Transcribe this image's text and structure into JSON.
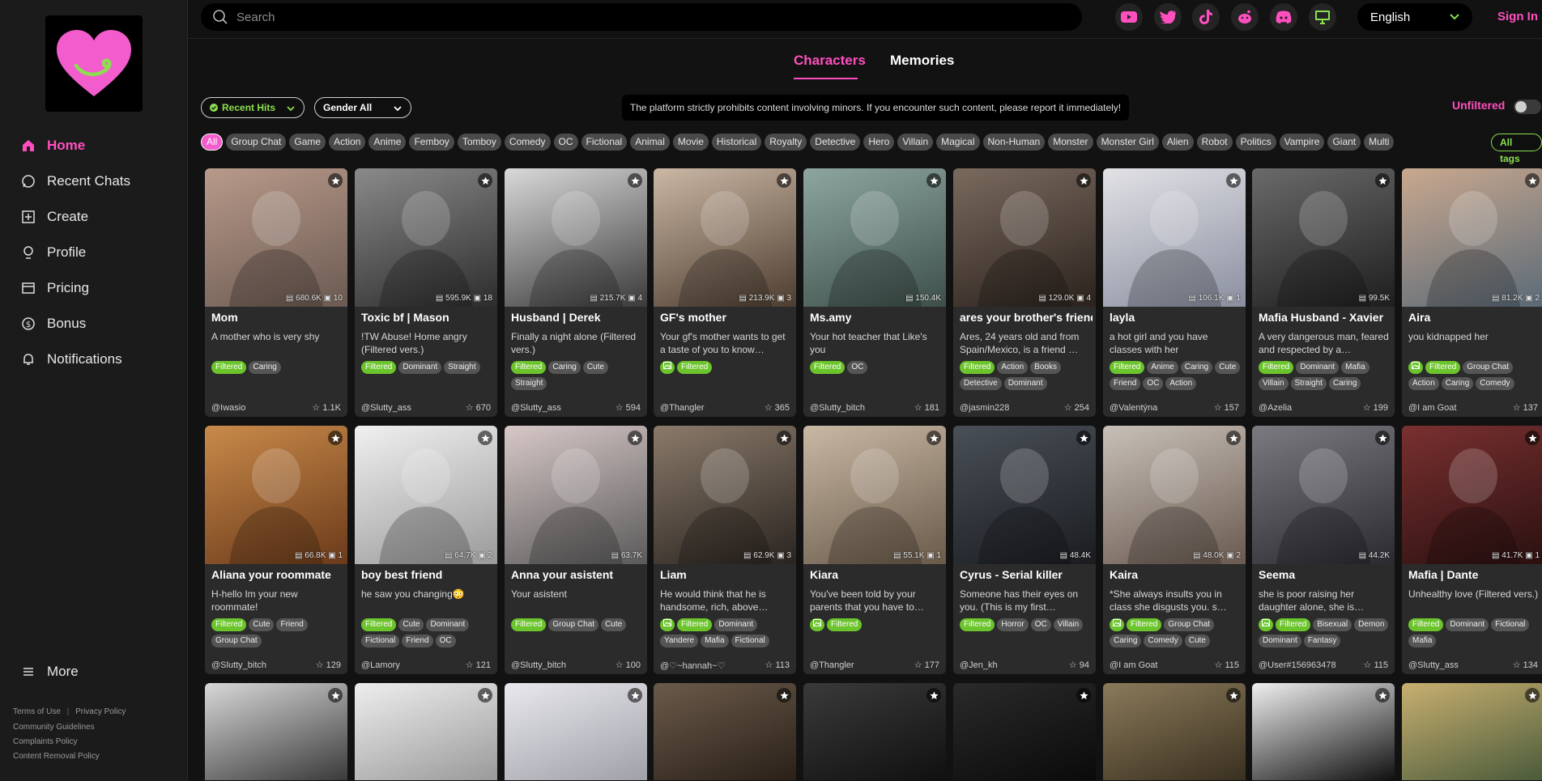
{
  "search": {
    "placeholder": "Search"
  },
  "language": "English",
  "signin": "Sign In",
  "sidebar": {
    "items": [
      {
        "label": "Home",
        "icon": "home-icon",
        "active": true
      },
      {
        "label": "Recent Chats",
        "icon": "chat-icon"
      },
      {
        "label": "Create",
        "icon": "plus-square-icon"
      },
      {
        "label": "Profile",
        "icon": "profile-icon"
      },
      {
        "label": "Pricing",
        "icon": "pricing-icon"
      },
      {
        "label": "Bonus",
        "icon": "dollar-icon"
      },
      {
        "label": "Notifications",
        "icon": "bell-icon"
      }
    ],
    "more": "More",
    "footer": {
      "terms": "Terms of Use",
      "privacy": "Privacy Policy",
      "community": "Community Guidelines",
      "complaints": "Complaints Policy",
      "removal": "Content Removal Policy"
    }
  },
  "social_icons": [
    "youtube-icon",
    "twitter-icon",
    "tiktok-icon",
    "reddit-icon",
    "discord-icon",
    "desktop-icon"
  ],
  "tabs": {
    "characters": "Characters",
    "memories": "Memories"
  },
  "filters": {
    "sort": "Recent Hits",
    "gender": "Gender All",
    "unfiltered": "Unfiltered"
  },
  "notice": "The platform strictly prohibits content involving minors. If you encounter such content, please report it immediately!",
  "tags": [
    "All",
    "Group Chat",
    "Game",
    "Action",
    "Anime",
    "Femboy",
    "Tomboy",
    "Comedy",
    "OC",
    "Fictional",
    "Animal",
    "Movie",
    "Historical",
    "Royalty",
    "Detective",
    "Hero",
    "Villain",
    "Magical",
    "Non-Human",
    "Monster",
    "Monster Girl",
    "Alien",
    "Robot",
    "Politics",
    "Vampire",
    "Giant",
    "Multi"
  ],
  "all_tags": "All tags",
  "cards": [
    {
      "name": "Mom",
      "desc": "A mother who is very shy",
      "views": "680.6K",
      "msgs": "10",
      "tags": [
        "Filtered",
        "Caring"
      ],
      "img_tag": false,
      "author": "@Iwasio",
      "stars": "1.1K"
    },
    {
      "name": "Toxic bf | Mason",
      "desc": "!TW Abuse! Home angry (Filtered vers.)",
      "views": "595.9K",
      "msgs": "18",
      "tags": [
        "Filtered",
        "Dominant",
        "Straight"
      ],
      "img_tag": false,
      "author": "@Slutty_ass",
      "stars": "670"
    },
    {
      "name": "Husband | Derek",
      "desc": "Finally a night alone (Filtered vers.)",
      "views": "215.7K",
      "msgs": "4",
      "tags": [
        "Filtered",
        "Caring",
        "Cute",
        "Straight"
      ],
      "img_tag": false,
      "author": "@Slutty_ass",
      "stars": "594"
    },
    {
      "name": "GF's mother",
      "desc": "Your gf's mother wants to get a taste of you to know…",
      "views": "213.9K",
      "msgs": "3",
      "tags": [
        "Filtered"
      ],
      "img_tag": true,
      "author": "@Thangler",
      "stars": "365"
    },
    {
      "name": "Ms.amy",
      "desc": "Your hot teacher that Like's you",
      "views": "150.4K",
      "msgs": "",
      "tags": [
        "Filtered",
        "OC"
      ],
      "img_tag": false,
      "author": "@Slutty_bitch",
      "stars": "181"
    },
    {
      "name": "ares your brother's friend",
      "desc": "Ares, 24 years old and from Spain/Mexico, is a friend …",
      "views": "129.0K",
      "msgs": "4",
      "tags": [
        "Filtered",
        "Action",
        "Books",
        "Detective",
        "Dominant"
      ],
      "img_tag": false,
      "author": "@jasmin228",
      "stars": "254"
    },
    {
      "name": "layla",
      "desc": "a hot girl and you have classes with her",
      "views": "106.1K",
      "msgs": "1",
      "tags": [
        "Filtered",
        "Anime",
        "Caring",
        "Cute",
        "Friend",
        "OC",
        "Action"
      ],
      "img_tag": false,
      "author": "@Valentýna",
      "stars": "157"
    },
    {
      "name": "Mafia Husband - Xavier",
      "desc": "A very dangerous man, feared and respected by a…",
      "views": "99.5K",
      "msgs": "",
      "tags": [
        "Filtered",
        "Dominant",
        "Mafia",
        "Villain",
        "Straight",
        "Caring"
      ],
      "img_tag": false,
      "author": "@Azelia",
      "stars": "199"
    },
    {
      "name": "Aira",
      "desc": "you kidnapped her",
      "views": "81.2K",
      "msgs": "2",
      "tags": [
        "Filtered",
        "Group Chat",
        "Action",
        "Caring",
        "Comedy"
      ],
      "img_tag": true,
      "author": "@I am Goat",
      "stars": "137"
    },
    {
      "name": "Aliana your roommate",
      "desc": "H-hello Im your new roommate!",
      "views": "66.8K",
      "msgs": "1",
      "tags": [
        "Filtered",
        "Cute",
        "Friend",
        "Group Chat"
      ],
      "img_tag": false,
      "author": "@Slutty_bitch",
      "stars": "129"
    },
    {
      "name": "boy best friend",
      "desc": "he saw you changing😳",
      "views": "64.7K",
      "msgs": "2",
      "tags": [
        "Filtered",
        "Cute",
        "Dominant",
        "Fictional",
        "Friend",
        "OC"
      ],
      "img_tag": false,
      "author": "@Lamory",
      "stars": "121"
    },
    {
      "name": "Anna your asistent",
      "desc": "Your asistent",
      "views": "63.7K",
      "msgs": "",
      "tags": [
        "Filtered",
        "Group Chat",
        "Cute"
      ],
      "img_tag": false,
      "author": "@Slutty_bitch",
      "stars": "100"
    },
    {
      "name": "Liam",
      "desc": "He would think that he is handsome, rich, above…",
      "views": "62.9K",
      "msgs": "3",
      "tags": [
        "Filtered",
        "Dominant",
        "Yandere",
        "Mafia",
        "Fictional"
      ],
      "img_tag": true,
      "author": "@♡~hannah~♡",
      "stars": "113"
    },
    {
      "name": "Kiara",
      "desc": "You've been told by your parents that you have to…",
      "views": "55.1K",
      "msgs": "1",
      "tags": [
        "Filtered"
      ],
      "img_tag": true,
      "author": "@Thangler",
      "stars": "177"
    },
    {
      "name": "Cyrus - Serial killer",
      "desc": "Someone has their eyes on you. (This is my first…",
      "views": "48.4K",
      "msgs": "",
      "tags": [
        "Filtered",
        "Horror",
        "OC",
        "Villain"
      ],
      "img_tag": false,
      "author": "@Jen_kh",
      "stars": "94"
    },
    {
      "name": "Kaira",
      "desc": "*She always insults you in class she disgusts you. s…",
      "views": "48.0K",
      "msgs": "2",
      "tags": [
        "Filtered",
        "Group Chat",
        "Caring",
        "Comedy",
        "Cute"
      ],
      "img_tag": true,
      "author": "@I am Goat",
      "stars": "115"
    },
    {
      "name": "Seema",
      "desc": "she is poor raising her daughter alone, she is…",
      "views": "44.2K",
      "msgs": "",
      "tags": [
        "Filtered",
        "Bisexual",
        "Demon",
        "Dominant",
        "Fantasy"
      ],
      "img_tag": true,
      "author": "@User#156963478",
      "stars": "115"
    },
    {
      "name": "Mafia | Dante",
      "desc": "Unhealthy love (Filtered vers.)",
      "views": "41.7K",
      "msgs": "1",
      "tags": [
        "Filtered",
        "Dominant",
        "Fictional",
        "Mafia"
      ],
      "img_tag": false,
      "author": "@Slutty_ass",
      "stars": "134"
    }
  ],
  "colors": {
    "accent": "#ff4fbf",
    "filtered": "#6cc42c",
    "bg": "#121212"
  }
}
